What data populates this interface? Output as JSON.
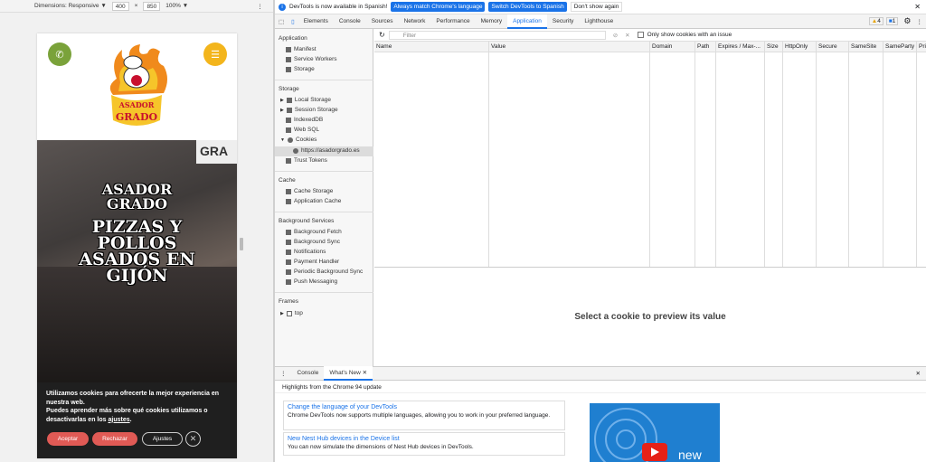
{
  "device_toolbar": {
    "dimensions_label": "Dimensions: Responsive ▼",
    "width": "400",
    "times": "×",
    "height": "850",
    "zoom": "100% ▼",
    "more": "⋮"
  },
  "site": {
    "logo_text_line1": "ASADOR",
    "logo_text_line2": "GRADO",
    "hero_line1": "ASADOR",
    "hero_line2": "GRADO",
    "hero_line3": "PIZZAS Y",
    "hero_line4": "POLLOS",
    "hero_line5": "ASADOS EN",
    "hero_line6": "GIJÓN",
    "sign_text": "GRA",
    "cookie_text1": "Utilizamos cookies para ofrecerte la mejor experiencia en nuestra web.",
    "cookie_text2_pre": "Puedes aprender más sobre qué cookies utilizamos o desactivarlas en los ",
    "cookie_text2_link": "ajustes",
    "cookie_text2_post": ".",
    "accept": "Aceptar",
    "reject": "Rechazar",
    "settings": "Ajustes",
    "close": "✕"
  },
  "devtools": {
    "infobar": {
      "text": "DevTools is now available in Spanish!",
      "btn1": "Always match Chrome's language",
      "btn2": "Switch DevTools to Spanish",
      "btn3": "Don't show again"
    },
    "tabs": [
      "Elements",
      "Console",
      "Sources",
      "Network",
      "Performance",
      "Memory",
      "Application",
      "Security",
      "Lighthouse"
    ],
    "warn_count": "4",
    "msg_count": "1",
    "sidebar": {
      "application": "Application",
      "manifest": "Manifest",
      "service_workers": "Service Workers",
      "storage_item": "Storage",
      "storage": "Storage",
      "local_storage": "Local Storage",
      "session_storage": "Session Storage",
      "indexeddb": "IndexedDB",
      "websql": "Web SQL",
      "cookies": "Cookies",
      "cookie_origin": "https://asadorgrado.es",
      "trust_tokens": "Trust Tokens",
      "cache": "Cache",
      "cache_storage": "Cache Storage",
      "app_cache": "Application Cache",
      "bg_services": "Background Services",
      "bg_fetch": "Background Fetch",
      "bg_sync": "Background Sync",
      "notifications": "Notifications",
      "payment_handler": "Payment Handler",
      "periodic_sync": "Periodic Background Sync",
      "push": "Push Messaging",
      "frames": "Frames",
      "top": "top"
    },
    "filter_placeholder": "Filter",
    "only_issue_label": "Only show cookies with an issue",
    "columns": [
      "Name",
      "Value",
      "Domain",
      "Path",
      "Expires / Max-...",
      "Size",
      "HttpOnly",
      "Secure",
      "SameSite",
      "SameParty",
      "Pri"
    ],
    "preview_text": "Select a cookie to preview its value",
    "drawer_tabs": [
      "Console",
      "What's New"
    ],
    "highlights": "Highlights from the Chrome 94 update",
    "cards": [
      {
        "title": "Change the language of your DevTools",
        "desc": "Chrome DevTools now supports multiple languages, allowing you to work in your preferred language."
      },
      {
        "title": "New Nest Hub devices in the Device list",
        "desc": "You can now simulate the dimensions of Nest Hub devices in DevTools."
      }
    ],
    "video_label": "new"
  }
}
